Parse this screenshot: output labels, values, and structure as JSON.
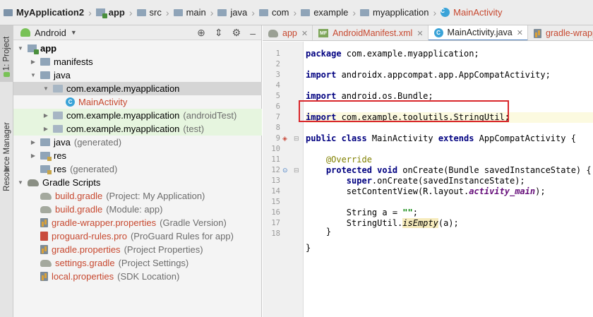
{
  "breadcrumb": [
    {
      "label": "MyApplication2",
      "icon": "folder-icon",
      "style": "bold"
    },
    {
      "label": "app",
      "icon": "module-icon",
      "style": "bold"
    },
    {
      "label": "src",
      "icon": "folder-icon",
      "style": ""
    },
    {
      "label": "main",
      "icon": "folder-icon",
      "style": ""
    },
    {
      "label": "java",
      "icon": "folder-icon",
      "style": ""
    },
    {
      "label": "com",
      "icon": "folder-icon",
      "style": ""
    },
    {
      "label": "example",
      "icon": "folder-icon",
      "style": ""
    },
    {
      "label": "myapplication",
      "icon": "folder-icon",
      "style": ""
    },
    {
      "label": "MainActivity",
      "icon": "class-icon",
      "style": "red"
    }
  ],
  "strip": {
    "project_tab": "1: Project",
    "resource_tab": "Resource Manager"
  },
  "project_panel": {
    "view_mode": "Android",
    "tree": [
      {
        "label": "app",
        "suffix": "",
        "type": "module",
        "arrow": "open",
        "depth": 0,
        "color": "bold"
      },
      {
        "label": "manifests",
        "suffix": "",
        "type": "folder",
        "arrow": "closed",
        "depth": 1,
        "color": ""
      },
      {
        "label": "java",
        "suffix": "",
        "type": "folder",
        "arrow": "open",
        "depth": 1,
        "color": ""
      },
      {
        "label": "com.example.myapplication",
        "suffix": "",
        "type": "package",
        "arrow": "open",
        "depth": 2,
        "color": "",
        "state": "sel"
      },
      {
        "label": "MainActivity",
        "suffix": "",
        "type": "class",
        "arrow": "none",
        "depth": 3,
        "color": "red"
      },
      {
        "label": "com.example.myapplication",
        "suffix": "(androidTest)",
        "type": "package",
        "arrow": "closed",
        "depth": 2,
        "color": "",
        "state": "test"
      },
      {
        "label": "com.example.myapplication",
        "suffix": "(test)",
        "type": "package",
        "arrow": "closed",
        "depth": 2,
        "color": "",
        "state": "test"
      },
      {
        "label": "java",
        "suffix": "(generated)",
        "type": "folder",
        "arrow": "closed",
        "depth": 1,
        "color": ""
      },
      {
        "label": "res",
        "suffix": "",
        "type": "res",
        "arrow": "closed",
        "depth": 1,
        "color": ""
      },
      {
        "label": "res",
        "suffix": "(generated)",
        "type": "res",
        "arrow": "none",
        "depth": 1,
        "color": ""
      },
      {
        "label": "Gradle Scripts",
        "suffix": "",
        "type": "gradle",
        "arrow": "open",
        "depth": 0,
        "color": ""
      },
      {
        "label": "build.gradle",
        "suffix": "(Project: My Application)",
        "type": "gradle",
        "arrow": "none",
        "depth": 1,
        "color": "red"
      },
      {
        "label": "build.gradle",
        "suffix": "(Module: app)",
        "type": "gradle",
        "arrow": "none",
        "depth": 1,
        "color": "red"
      },
      {
        "label": "gradle-wrapper.properties",
        "suffix": "(Gradle Version)",
        "type": "props",
        "arrow": "none",
        "depth": 1,
        "color": "red"
      },
      {
        "label": "proguard-rules.pro",
        "suffix": "(ProGuard Rules for app)",
        "type": "proguard",
        "arrow": "none",
        "depth": 1,
        "color": "red"
      },
      {
        "label": "gradle.properties",
        "suffix": "(Project Properties)",
        "type": "props",
        "arrow": "none",
        "depth": 1,
        "color": "red"
      },
      {
        "label": "settings.gradle",
        "suffix": "(Project Settings)",
        "type": "gradle",
        "arrow": "none",
        "depth": 1,
        "color": "red"
      },
      {
        "label": "local.properties",
        "suffix": "(SDK Location)",
        "type": "props",
        "arrow": "none",
        "depth": 1,
        "color": "red"
      }
    ]
  },
  "editor": {
    "tabs": [
      {
        "label": "app",
        "icon": "gradle-icon",
        "active": false
      },
      {
        "label": "AndroidManifest.xml",
        "icon": "manifest-icon",
        "active": false
      },
      {
        "label": "MainActivity.java",
        "icon": "class-icon",
        "active": true
      },
      {
        "label": "gradle-wrappe",
        "icon": "properties-icon",
        "active": false
      }
    ],
    "line_numbers": [
      "1",
      "2",
      "3",
      "4",
      "5",
      "6",
      "7",
      "8",
      "9",
      "10",
      "11",
      "12",
      "13",
      "14",
      "15",
      "16",
      "17",
      "18"
    ],
    "code": {
      "l1": [
        "package",
        " com.example.myapplication;"
      ],
      "l3": [
        "import",
        " androidx.appcompat.app.AppCompatActivity;"
      ],
      "l5": [
        "import",
        " android.os.Bundle;"
      ],
      "l7": [
        "import",
        " com.example.toolutils.StringUtil;"
      ],
      "l9": [
        "public class",
        " MainActivity ",
        "extends",
        " AppCompatActivity {"
      ],
      "l11": [
        "    @Override"
      ],
      "l12": [
        "    ",
        "protected void",
        " onCreate(Bundle savedInstanceState) {"
      ],
      "l13": [
        "        ",
        "super",
        ".onCreate(savedInstanceState);"
      ],
      "l14": [
        "        setContentView(R.layout.",
        "activity_main",
        ");"
      ],
      "l16": [
        "        String a = ",
        "\"\"",
        ";"
      ],
      "l17": [
        "        StringUtil.",
        "isEmpty",
        "(a);"
      ],
      "l19": [
        "    }"
      ],
      "l20": [
        "}"
      ]
    }
  },
  "colors": {
    "accent": "#4a7fc1",
    "highlight_box": "#d9262b",
    "red_text": "#c7482f"
  }
}
